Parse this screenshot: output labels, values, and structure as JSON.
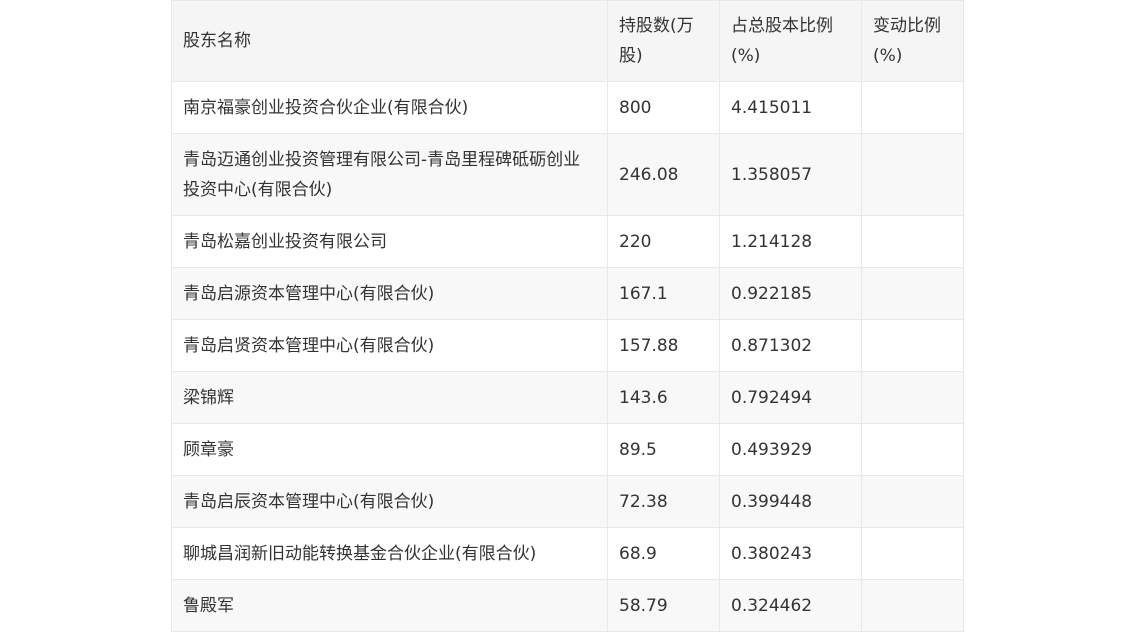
{
  "table": {
    "headers": [
      "股东名称",
      "持股数(万股)",
      "占总股本比例(%)",
      "变动比例(%)"
    ],
    "rows": [
      [
        "南京福豪创业投资合伙企业(有限合伙)",
        "800",
        "4.415011",
        ""
      ],
      [
        "青岛迈通创业投资管理有限公司-青岛里程碑砥砺创业投资中心(有限合伙)",
        "246.08",
        "1.358057",
        ""
      ],
      [
        "青岛松嘉创业投资有限公司",
        "220",
        "1.214128",
        ""
      ],
      [
        "青岛启源资本管理中心(有限合伙)",
        "167.1",
        "0.922185",
        ""
      ],
      [
        "青岛启贤资本管理中心(有限合伙)",
        "157.88",
        "0.871302",
        ""
      ],
      [
        "梁锦辉",
        "143.6",
        "0.792494",
        ""
      ],
      [
        "顾章豪",
        "89.5",
        "0.493929",
        ""
      ],
      [
        "青岛启辰资本管理中心(有限合伙)",
        "72.38",
        "0.399448",
        ""
      ],
      [
        "聊城昌润新旧动能转换基金合伙企业(有限合伙)",
        "68.9",
        "0.380243",
        ""
      ],
      [
        "鲁殿军",
        "58.79",
        "0.324462",
        ""
      ]
    ]
  }
}
